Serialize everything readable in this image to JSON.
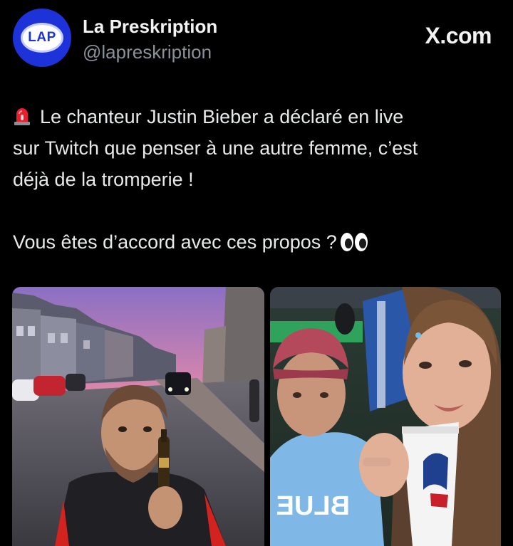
{
  "account": {
    "avatar_text": "LAP",
    "display_name": "La Preskription",
    "handle": "@lapreskription"
  },
  "source": {
    "label": "X.com"
  },
  "post": {
    "line1": "Le chanteur Justin Bieber a déclaré en live",
    "line2": "sur Twitch que penser à une autre femme, c’est",
    "line3": "déjà de la tromperie !",
    "line4": "Vous êtes d’accord avec ces propos ?",
    "lead_emoji": "rotating-light-icon",
    "trail_emoji": "eyes-icon"
  },
  "media": {
    "left_photo": "street-sunset-photo",
    "right_photo": "stadium-selfie-photo",
    "jersey_text": "BLUE J"
  },
  "colors": {
    "background": "#000000",
    "avatar_blue": "#1d33d9",
    "text_primary": "#e7e9ea",
    "text_secondary": "#8b9199"
  }
}
